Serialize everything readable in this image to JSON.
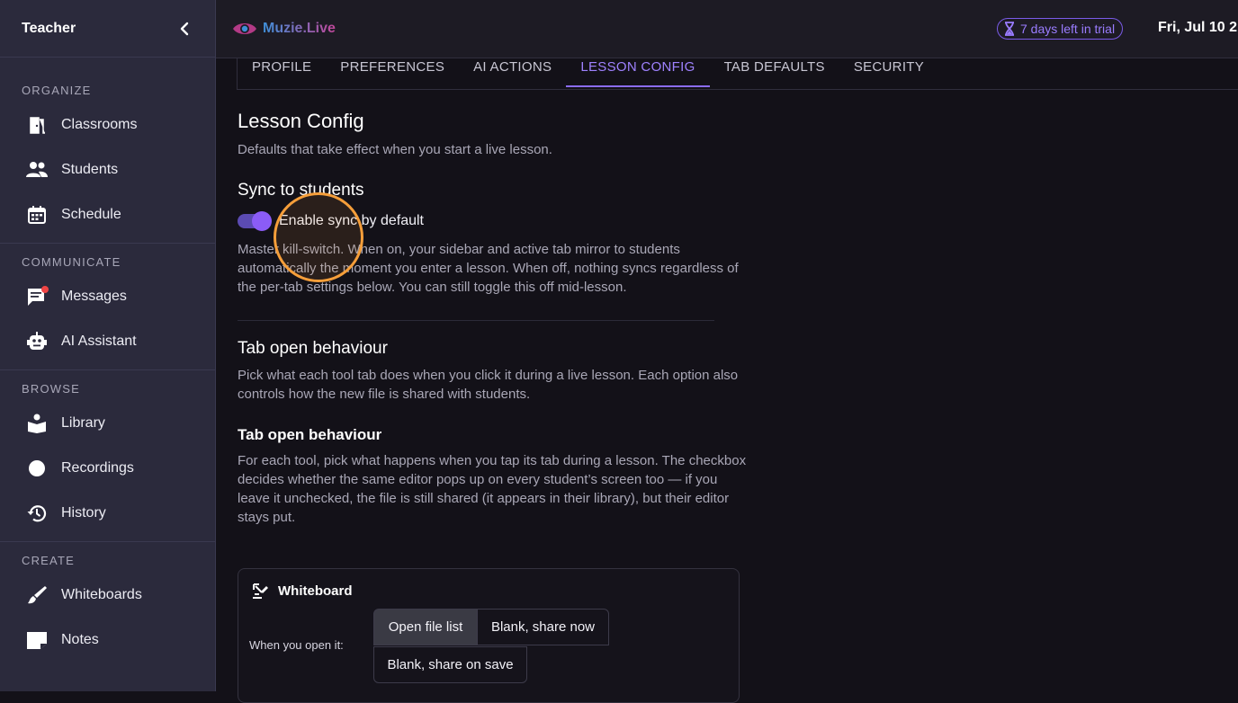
{
  "sidebar": {
    "title": "Teacher",
    "sections": [
      {
        "label": "ORGANIZE",
        "items": [
          {
            "label": "Classrooms",
            "icon": "door-icon"
          },
          {
            "label": "Students",
            "icon": "people-icon"
          },
          {
            "label": "Schedule",
            "icon": "calendar-icon"
          }
        ]
      },
      {
        "label": "COMMUNICATE",
        "items": [
          {
            "label": "Messages",
            "icon": "message-icon"
          },
          {
            "label": "AI Assistant",
            "icon": "robot-icon"
          }
        ]
      },
      {
        "label": "BROWSE",
        "items": [
          {
            "label": "Library",
            "icon": "book-icon"
          },
          {
            "label": "Recordings",
            "icon": "record-icon"
          },
          {
            "label": "History",
            "icon": "history-icon"
          }
        ]
      },
      {
        "label": "CREATE",
        "items": [
          {
            "label": "Whiteboards",
            "icon": "brush-icon"
          },
          {
            "label": "Notes",
            "icon": "note-icon"
          }
        ]
      }
    ]
  },
  "topbar": {
    "brand": "Muzie.Live",
    "trial": "7 days left in trial",
    "date": "Fri, Jul 10 2"
  },
  "tabs": [
    "PROFILE",
    "PREFERENCES",
    "AI ACTIONS",
    "LESSON CONFIG",
    "TAB DEFAULTS",
    "SECURITY"
  ],
  "active_tab": "LESSON CONFIG",
  "content": {
    "title": "Lesson Config",
    "subtitle": "Defaults that take effect when you start a live lesson.",
    "sync": {
      "heading": "Sync to students",
      "toggle_label": "Enable sync by default",
      "toggle_on": true,
      "description": "Master kill-switch. When on, your sidebar and active tab mirror to students automatically the moment you enter a lesson. When off, nothing syncs regardless of the per-tab settings below. You can still toggle this off mid-lesson."
    },
    "tab_open": {
      "heading": "Tab open behaviour",
      "description": "Pick what each tool tab does when you click it during a live lesson. Each option also controls how the new file is shared with students.",
      "sub_heading": "Tab open behaviour",
      "sub_description": "For each tool, pick what happens when you tap its tab during a lesson. The checkbox decides whether the same editor pops up on every student’s screen too — if you leave it unchecked, the file is still shared (it appears in their library), but their editor stays put."
    },
    "whiteboard_card": {
      "title": "Whiteboard",
      "open_label": "When you open it:",
      "options": [
        "Open file list",
        "Blank, share now",
        "Blank, share on save"
      ],
      "selected": "Open file list"
    }
  }
}
